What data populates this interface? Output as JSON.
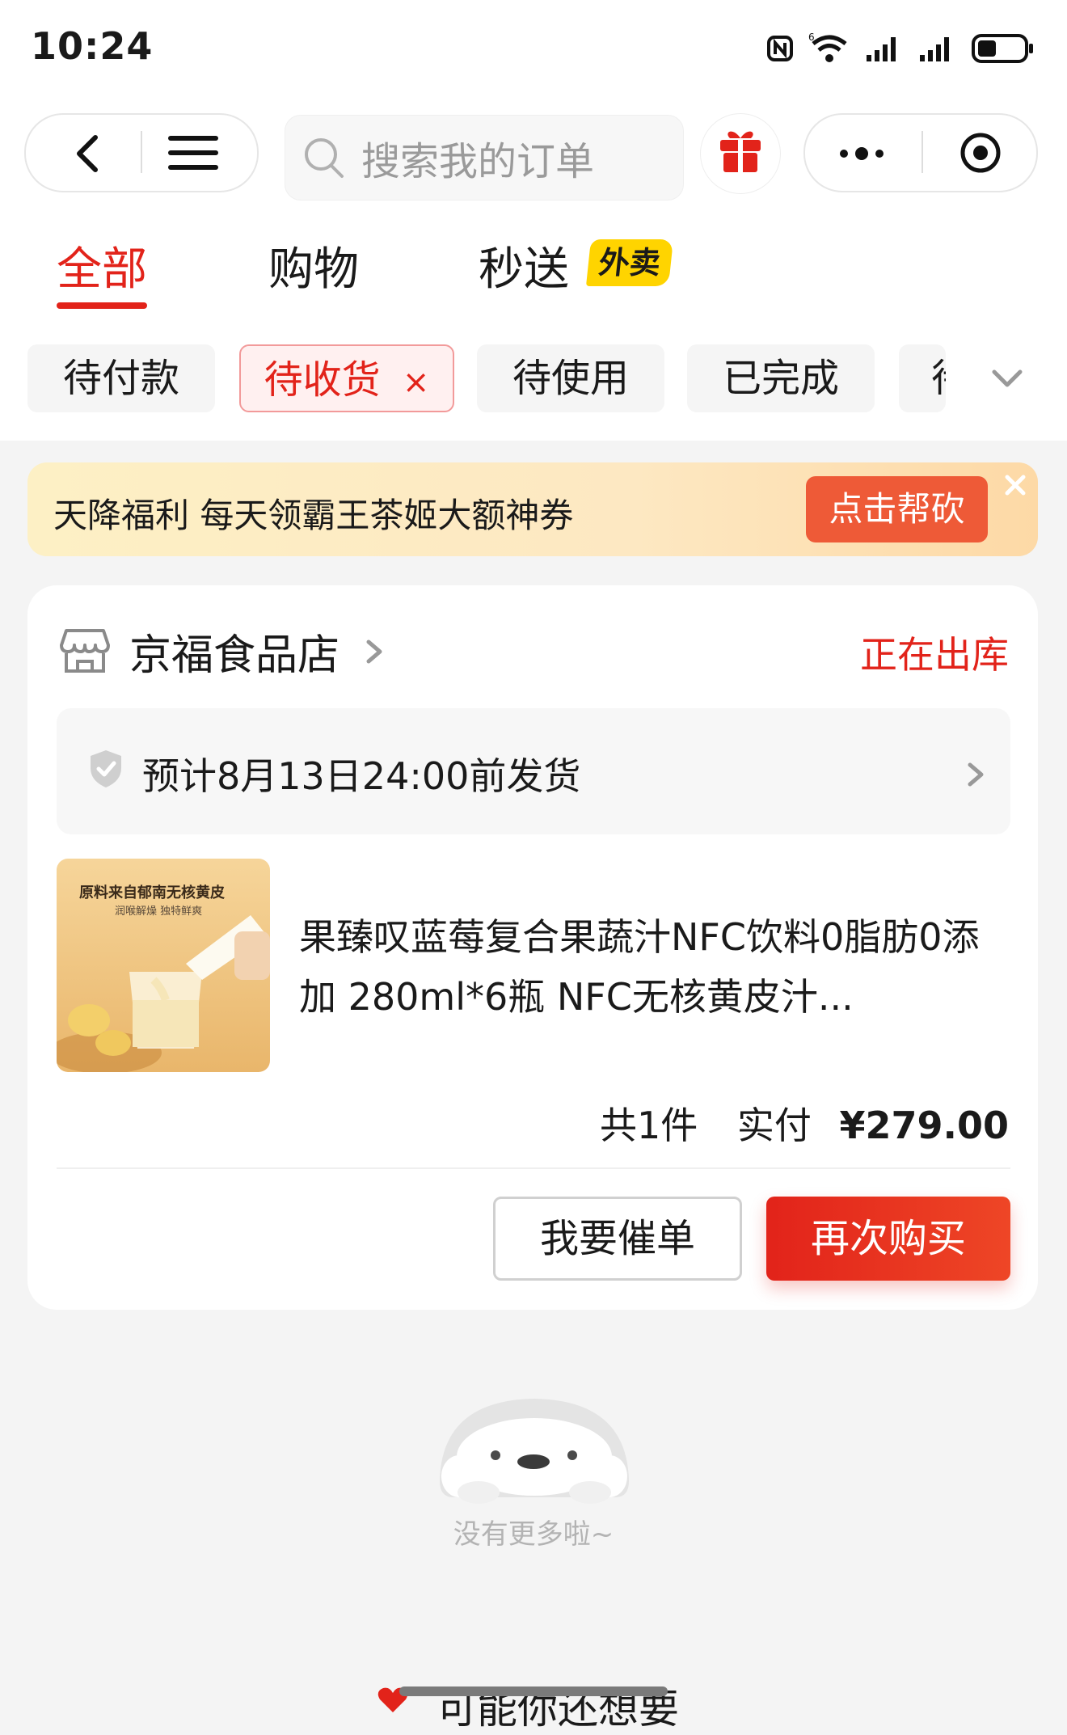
{
  "status_bar": {
    "time": "10:24",
    "icons": [
      "nfc-icon",
      "wifi-icon",
      "signal-icon",
      "signal-icon",
      "battery-icon"
    ]
  },
  "header": {
    "search_placeholder": "搜索我的订单",
    "icons": [
      "back-icon",
      "menu-icon",
      "search-icon",
      "gift-icon",
      "more-icon",
      "record-icon"
    ]
  },
  "tabs": [
    {
      "label": "全部",
      "active": true
    },
    {
      "label": "购物",
      "active": false
    },
    {
      "label": "秒送",
      "active": false,
      "badge": "外卖"
    }
  ],
  "filters": [
    {
      "label": "待付款",
      "active": false
    },
    {
      "label": "待收货",
      "active": true
    },
    {
      "label": "待使用",
      "active": false
    },
    {
      "label": "已完成",
      "active": false
    },
    {
      "label": "待",
      "active": false
    }
  ],
  "banner": {
    "text": "天降福利 每天领霸王茶姬大额神券",
    "button": "点击帮砍"
  },
  "order": {
    "shop_name": "京福食品店",
    "status": "正在出库",
    "shipping": "预计8月13日24:00前发货",
    "product_title": "果臻叹蓝莓复合果蔬汁NFC饮料0脂肪0添加 280ml*6瓶 NFC无核黄皮汁...",
    "product_image_text": {
      "line1": "原料来自郁南无核黄皮",
      "line2": "润喉解燥 独特鲜爽"
    },
    "count": "共1件",
    "paid_label": "实付",
    "paid_amount": "¥279.00",
    "buttons": {
      "remind": "我要催单",
      "rebuy": "再次购买"
    }
  },
  "footer": {
    "no_more": "没有更多啦~",
    "recommend": "可能你还想要"
  },
  "colors": {
    "accent": "#e2231a",
    "banner_button": "#ee5a37",
    "badge_yellow": "#ffd400"
  }
}
